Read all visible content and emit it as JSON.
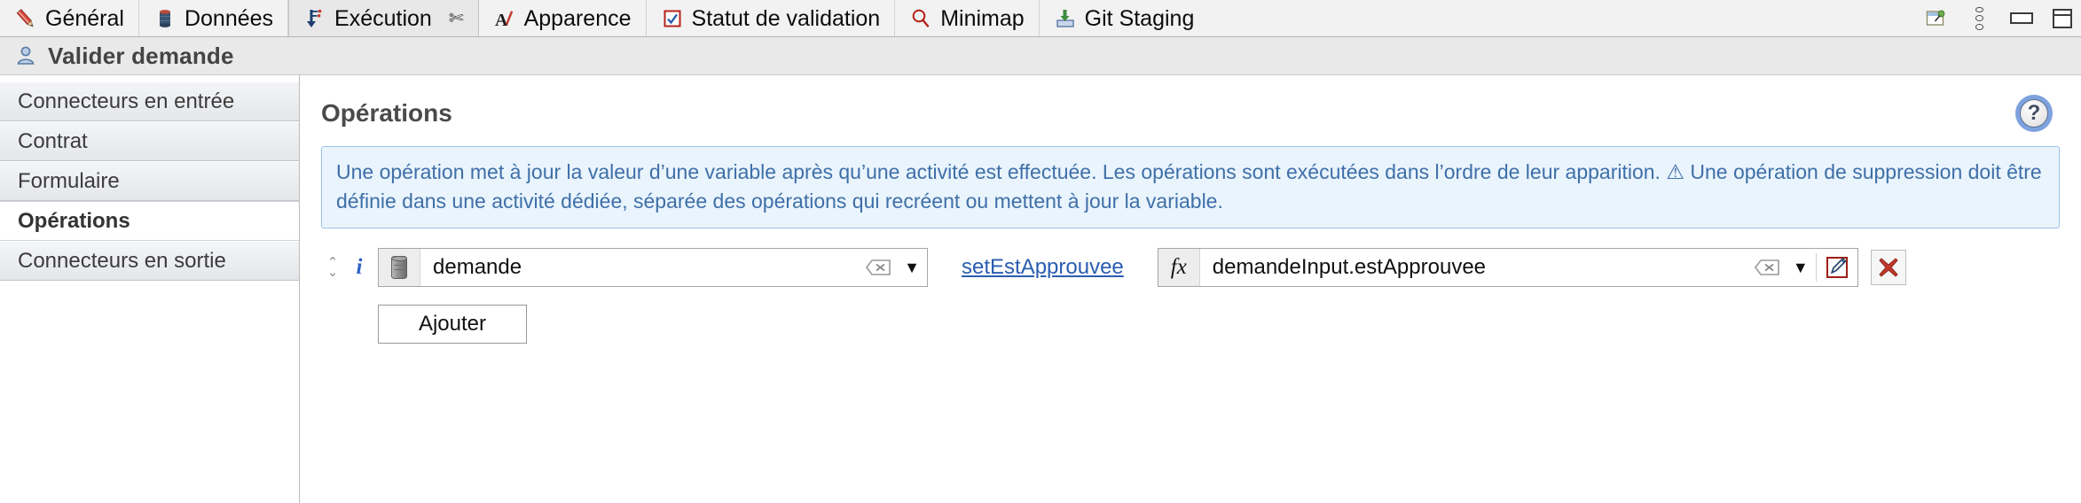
{
  "tabbar": {
    "tabs": [
      {
        "label": "Général",
        "icon": "pencil-icon",
        "active": false,
        "closable": false
      },
      {
        "label": "Données",
        "icon": "database-icon",
        "active": false,
        "closable": false
      },
      {
        "label": "Exécution",
        "icon": "execution-arrow-icon",
        "active": true,
        "closable": true,
        "close_glyph": "✄"
      },
      {
        "label": "Apparence",
        "icon": "font-style-icon",
        "active": false,
        "closable": false
      },
      {
        "label": "Statut de validation",
        "icon": "checkbox-checked-icon",
        "active": false,
        "closable": false
      },
      {
        "label": "Minimap",
        "icon": "magnifier-icon",
        "active": false,
        "closable": false
      },
      {
        "label": "Git Staging",
        "icon": "git-staging-icon",
        "active": false,
        "closable": false
      }
    ],
    "window_controls": [
      {
        "name": "restore-view-icon"
      },
      {
        "name": "view-menu-icon"
      },
      {
        "name": "minimize-icon"
      },
      {
        "name": "maximize-icon"
      }
    ]
  },
  "titlebar": {
    "icon": "user-task-icon",
    "title": "Valider demande"
  },
  "sidebar": {
    "items": [
      {
        "label": "Connecteurs en entrée",
        "selected": false
      },
      {
        "label": "Contrat",
        "selected": false
      },
      {
        "label": "Formulaire",
        "selected": false
      },
      {
        "label": "Opérations",
        "selected": true
      },
      {
        "label": "Connecteurs en sortie",
        "selected": false
      }
    ]
  },
  "content": {
    "section_title": "Opérations",
    "help_label": "?",
    "banner": {
      "text_before_warning": "Une opération met à jour la valeur d’une variable après qu’une activité est effectuée. Les opérations sont exécutées dans l’ordre de leur apparition. ",
      "warning_glyph": "⚠",
      "text_after_warning": " Une opération de suppression doit être définie dans une activité dédiée, séparée des opérations qui recréent ou mettent à jour la variable."
    },
    "operation_row": {
      "reorder_up": "⌃",
      "reorder_down": "⌄",
      "info_icon_label": "i",
      "variable_field": {
        "prefix_icon": "database-cylinder-icon",
        "value": "demande",
        "clear_label": "⌫",
        "caret_label": "▼"
      },
      "operator_link": "setEstApprouvee",
      "expression_field": {
        "prefix_icon": "fx-icon",
        "prefix_label": "fx",
        "value": "demandeInput.estApprouvee",
        "clear_label": "⌫",
        "caret_label": "▼",
        "edit_icon": "pencil-edit-icon"
      },
      "delete_icon": "red-x-delete-icon"
    },
    "add_button_label": "Ajouter"
  }
}
